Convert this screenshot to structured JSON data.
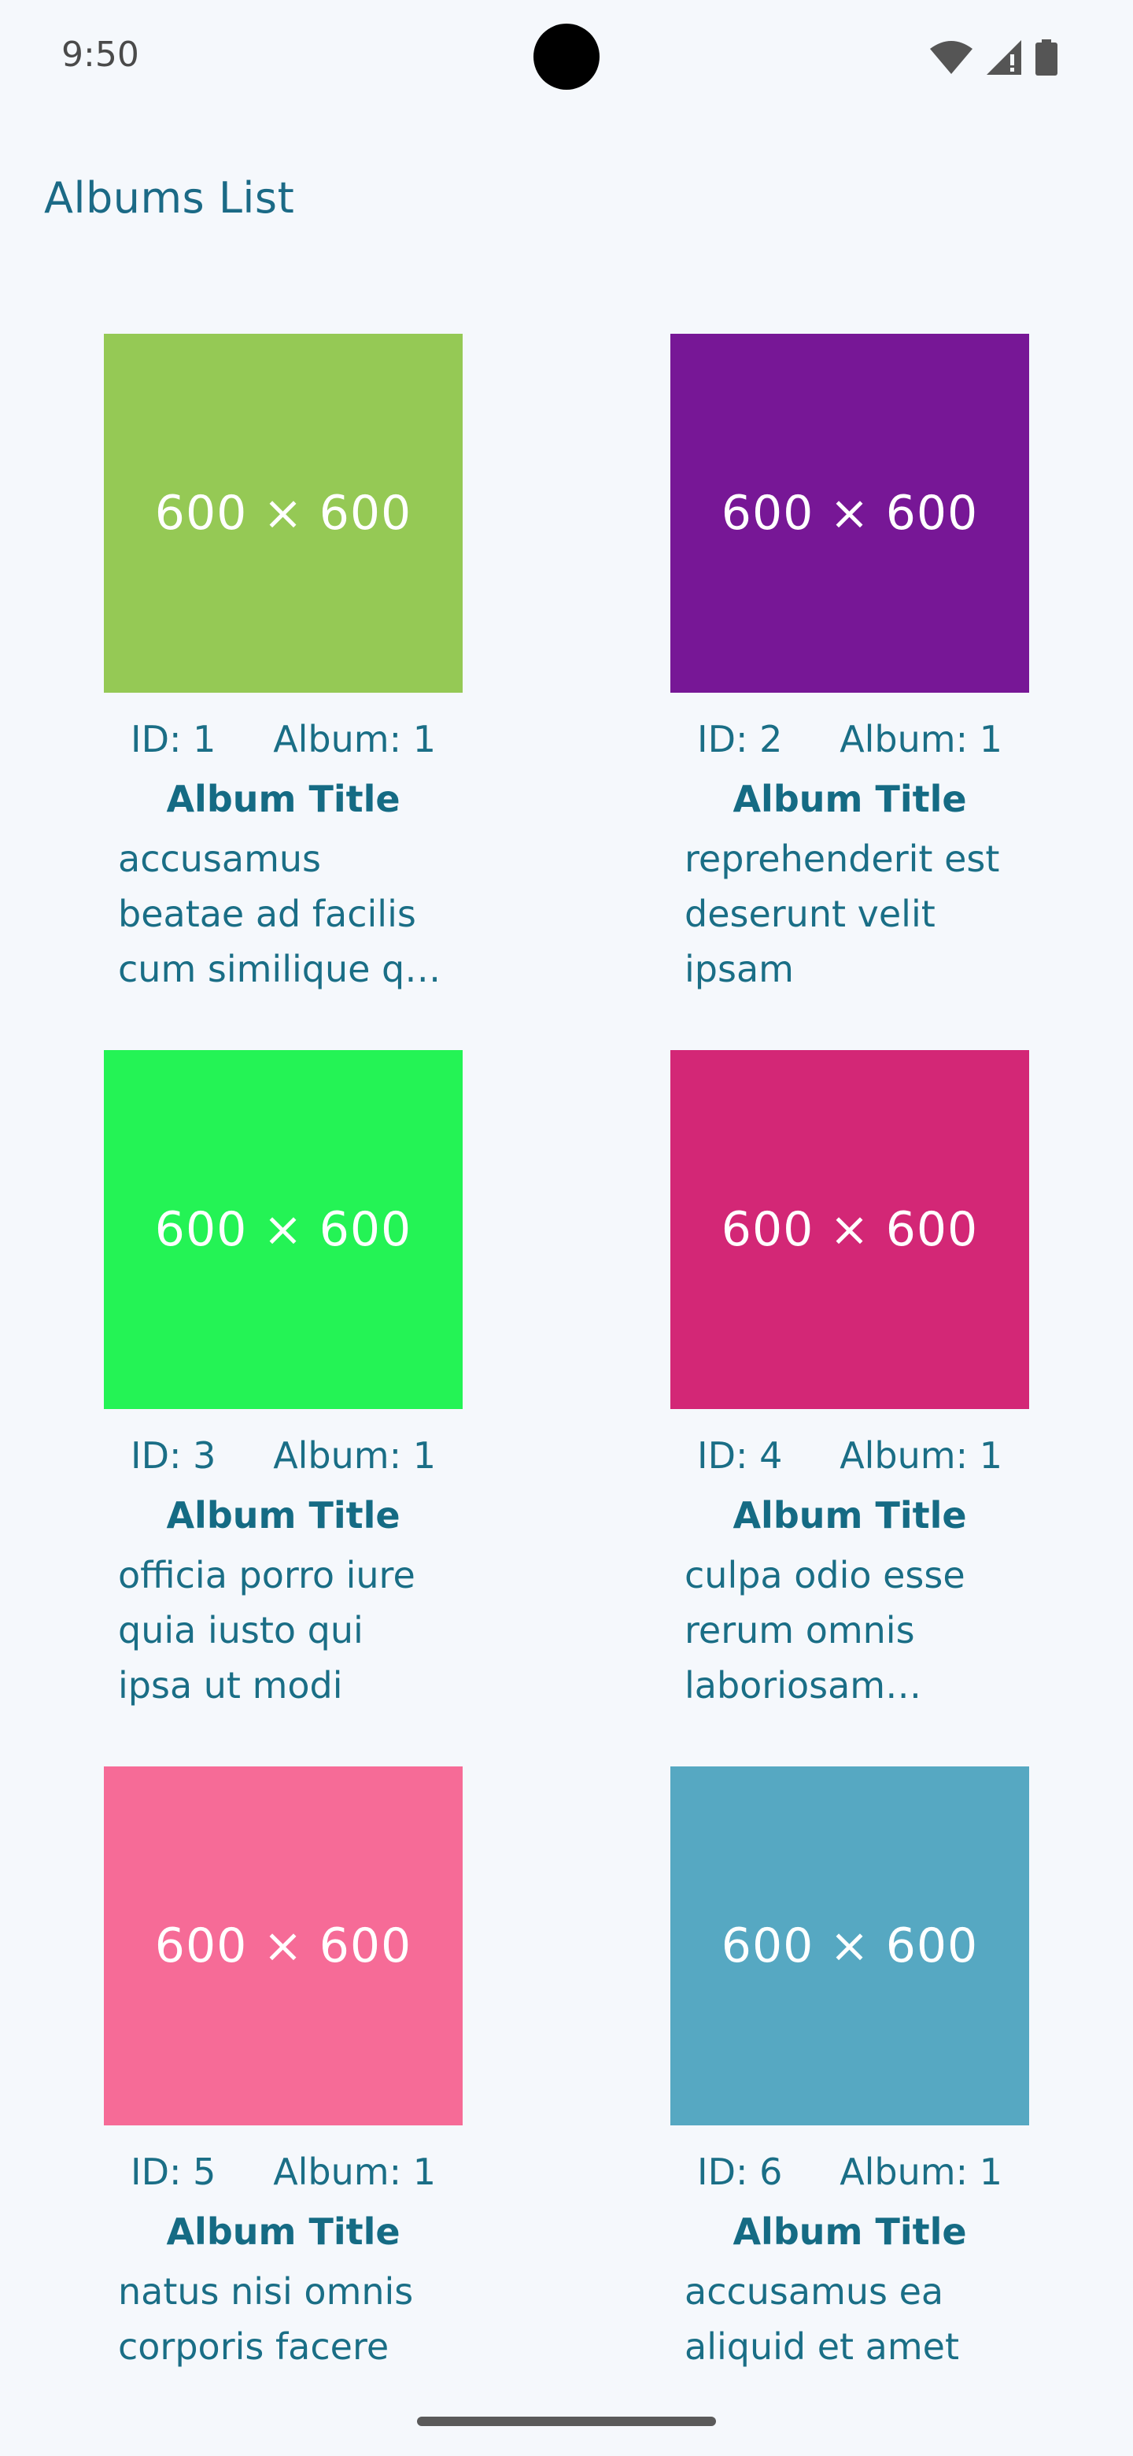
{
  "status_bar": {
    "time": "9:50",
    "icons": [
      "wifi-icon",
      "signal-icon",
      "battery-icon"
    ]
  },
  "header": {
    "title": "Albums List"
  },
  "colors": {
    "background": "#f5f8fc",
    "text_accent": "#1b6a86"
  },
  "albums": [
    {
      "thumb_label": "600 × 600",
      "thumb_color": "#95c955",
      "id_label": "ID: 1",
      "album_label": "Album: 1",
      "title_label": "Album Title",
      "description": "accusamus beatae ad facilis cum similique qui sunt"
    },
    {
      "thumb_label": "600 × 600",
      "thumb_color": "#771796",
      "id_label": "ID: 2",
      "album_label": "Album: 1",
      "title_label": "Album Title",
      "description": "reprehenderit est deserunt velit ipsam"
    },
    {
      "thumb_label": "600 × 600",
      "thumb_color": "#24f355",
      "id_label": "ID: 3",
      "album_label": "Album: 1",
      "title_label": "Album Title",
      "description": "officia porro iure quia iusto qui ipsa ut modi"
    },
    {
      "thumb_label": "600 × 600",
      "thumb_color": "#d32776",
      "id_label": "ID: 4",
      "album_label": "Album: 1",
      "title_label": "Album Title",
      "description": "culpa odio esse rerum omnis laboriosam voluptate repudiandae"
    },
    {
      "thumb_label": "600 × 600",
      "thumb_color": "#f66b97",
      "id_label": "ID: 5",
      "album_label": "Album: 1",
      "title_label": "Album Title",
      "description": "natus nisi omnis corporis facere"
    },
    {
      "thumb_label": "600 × 600",
      "thumb_color": "#56a8c2",
      "id_label": "ID: 6",
      "album_label": "Album: 1",
      "title_label": "Album Title",
      "description": "accusamus ea aliquid et amet"
    }
  ]
}
